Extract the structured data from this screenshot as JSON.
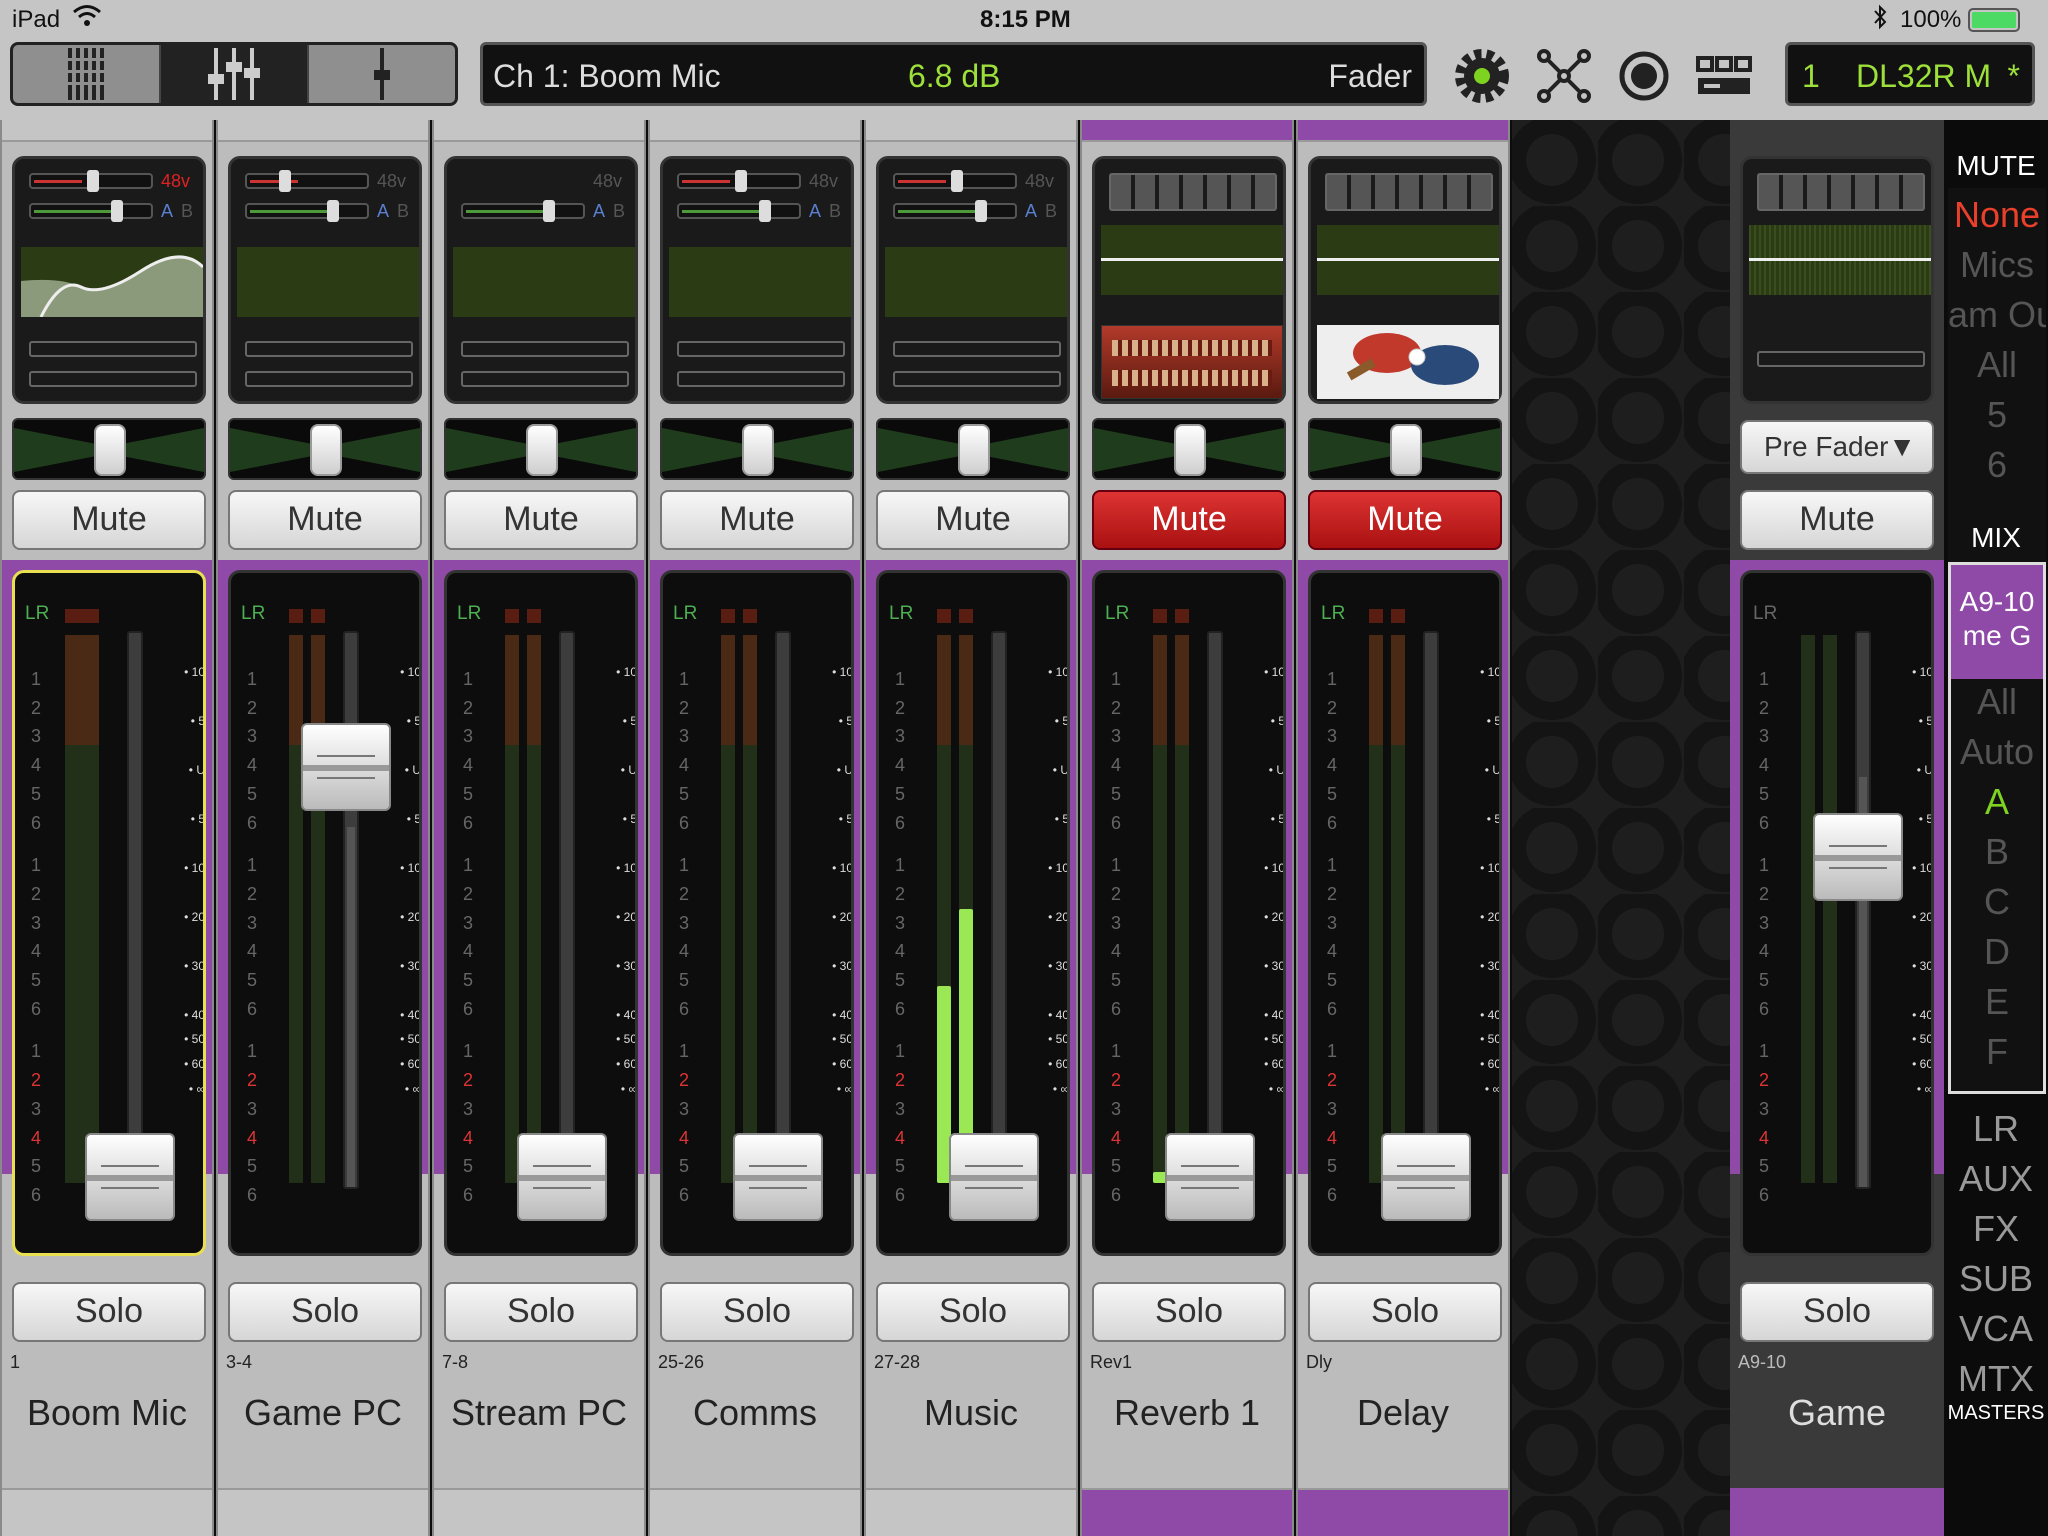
{
  "status": {
    "device": "iPad",
    "time": "8:15 PM",
    "battery": "100%"
  },
  "toolbar": {
    "views": [
      "meters-view",
      "mixer-view",
      "single-fader-view"
    ],
    "selected_view": 1,
    "channel_label": "Ch 1: Boom Mic",
    "value": "6.8 dB",
    "param": "Fader",
    "snapshot_num": "1",
    "mixer_model": "DL32R M",
    "modified_marker": "*",
    "accent": "#9de03a"
  },
  "strip_common": {
    "mute": "Mute",
    "solo": "Solo",
    "phantom": "48v",
    "a": "A",
    "b": "B",
    "lr": "LR"
  },
  "channels": [
    {
      "num": "1",
      "name": "Boom Mic",
      "muted": false,
      "phantom_on": true,
      "selected": true
    },
    {
      "num": "3-4",
      "name": "Game PC",
      "muted": false,
      "phantom_on": false,
      "selected": false
    },
    {
      "num": "7-8",
      "name": "Stream PC",
      "muted": false,
      "phantom_on": false,
      "selected": false
    },
    {
      "num": "25-26",
      "name": "Comms",
      "muted": false,
      "phantom_on": false,
      "selected": false
    },
    {
      "num": "27-28",
      "name": "Music",
      "muted": false,
      "phantom_on": false,
      "selected": false
    },
    {
      "num": "Rev1",
      "name": "Reverb 1",
      "muted": true,
      "selected": false
    },
    {
      "num": "Dly",
      "name": "Delay",
      "muted": true,
      "selected": false
    }
  ],
  "scale": [
    "10",
    "5",
    "U",
    "5",
    "10",
    "20",
    "30",
    "40",
    "50",
    "60",
    "∞"
  ],
  "groups": [
    "1",
    "2",
    "3",
    "4",
    "5",
    "6",
    "1",
    "2",
    "3",
    "4",
    "5",
    "6",
    "1",
    "2",
    "3",
    "4",
    "5",
    "6"
  ],
  "master": {
    "num": "A9-10",
    "name": "Game",
    "send_mode": "Pre Fader",
    "mute": "Mute",
    "solo": "Solo"
  },
  "right_panel": {
    "mute_title": "MUTE",
    "mute_groups": [
      "None",
      "Mics",
      "am Ou",
      "All",
      "5",
      "6"
    ],
    "mix_title": "MIX",
    "mix_selected": "A9-10 me G",
    "mix_items": [
      "All",
      "Auto",
      "A",
      "B",
      "C",
      "D",
      "E",
      "F"
    ],
    "masters": [
      "LR",
      "AUX",
      "FX",
      "SUB",
      "VCA",
      "MTX"
    ],
    "masters_title": "MASTERS"
  }
}
